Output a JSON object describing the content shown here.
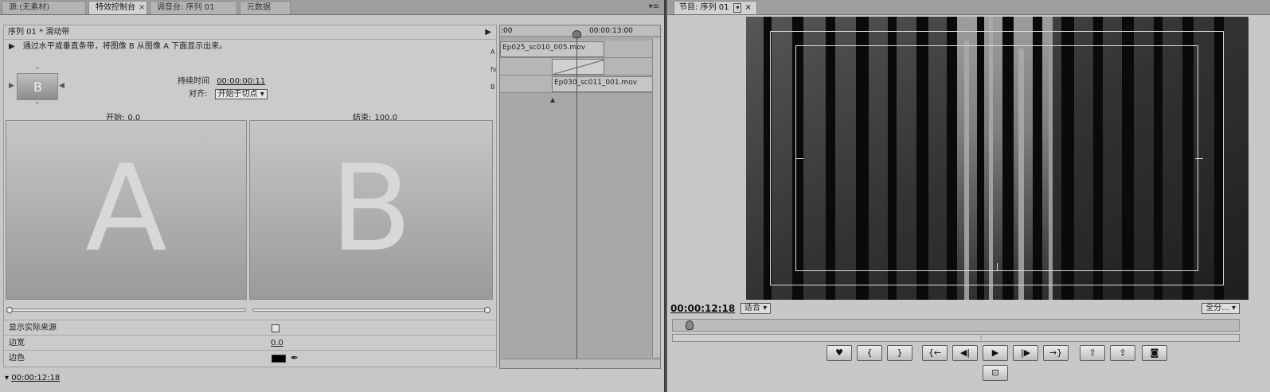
{
  "left_tabs": [
    {
      "label": "源:(无素材)",
      "active": false
    },
    {
      "label": "特效控制台",
      "active": true
    },
    {
      "label": "调音台: 序列 01",
      "active": false
    },
    {
      "label": "元数据",
      "active": false
    }
  ],
  "panel_menu_icon": "panel-menu-icon",
  "effect": {
    "sequence_title": "序列 01 * 滑动带",
    "description": "通过水平或垂直条带，将图像 B 从图像 A 下面显示出来。",
    "thumb_glyph": "B",
    "duration_label": "持续时间",
    "duration_value": "00:00:00:11",
    "align_label": "对齐:",
    "align_value": "开始于切点",
    "start_label": "开始:",
    "start_value": "0.0",
    "end_label": "结束:",
    "end_value": "100.0",
    "preview_a": "A",
    "preview_b": "B",
    "show_actual_sources_label": "显示实际来源",
    "border_width_label": "边宽",
    "border_width_value": "0.0",
    "border_color_label": "边色",
    "border_color": "#000000",
    "bottom_time": "00:00:12:18"
  },
  "mini_timeline": {
    "ruler_start": ":00",
    "ruler_mark": "00:00:13:00",
    "track_a_label": "A",
    "track_fx_label": "fx",
    "track_b_label": "B",
    "clip_a": "Ep025_sc010_005.mov",
    "clip_b": "Ep030_sc011_001.mov"
  },
  "program": {
    "tab_label": "节目: 序列 01",
    "current_time": "00:00:12:18",
    "fit_label": "适合",
    "resolution_label": "全分..."
  },
  "controls": {
    "row1": [
      {
        "name": "add-marker-button",
        "glyph": "♥"
      },
      {
        "name": "mark-in-button",
        "glyph": "{"
      },
      {
        "name": "mark-out-button",
        "glyph": "}"
      },
      {
        "name": "go-to-in-button",
        "glyph": "{←"
      },
      {
        "name": "step-back-button",
        "glyph": "◀|"
      },
      {
        "name": "play-button",
        "glyph": "▶"
      },
      {
        "name": "step-forward-button",
        "glyph": "|▶"
      },
      {
        "name": "go-to-out-button",
        "glyph": "→}"
      },
      {
        "name": "lift-button",
        "glyph": "⇧"
      },
      {
        "name": "extract-button",
        "glyph": "⇪"
      },
      {
        "name": "export-frame-button",
        "glyph": "◙"
      }
    ],
    "row2": [
      {
        "name": "safe-margins-button",
        "glyph": "⊡"
      }
    ]
  }
}
